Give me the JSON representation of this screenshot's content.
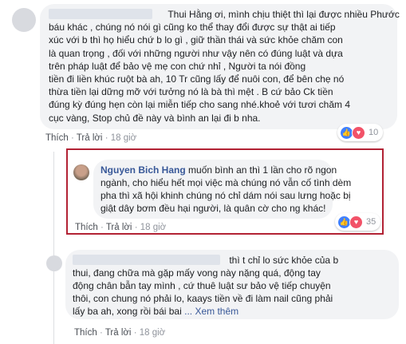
{
  "comment1": {
    "author": "",
    "lines": [
      "Thui Hằng ơi, mình chịu thiệt thì lại được nhiều Phước",
      "báu khác , chúng nó nói gì cũng ko thể thay đổi được sự thật ai tiếp",
      "xúc với b thì họ hiểu chứ b lo gì , giữ thần thái và sức khỏe chăm con",
      "là quan trọng , đối với những người như vậy nên có đúng luật và dựa",
      "trên pháp luật để bảo vệ mẹ con chứ nhỉ , Người ta nói đồng",
      "tiền đi liền khúc ruột bà ah, 10 Tr cũng lấy để nuôi con, để bên chẹ nó",
      "thừa tiền lại dững mỡ với tưởng nó là bà thì mệt . B cứ bảo Ck tiền",
      "đúng kỳ đúng hẹn còn lại miễn tiếp cho sang nhé.khoẻ với tươi chăm 4",
      "cục vàng, Stop chủ đề này và bình an lại đi b nha."
    ],
    "reaction_count": "10",
    "actions": {
      "like": "Thích",
      "reply": "Trả lời",
      "sep": "·",
      "time": "18 giờ"
    }
  },
  "comment2": {
    "author": "Nguyen Bich Hang",
    "first_line": " muốn bình an thì 1 lần cho rõ ngon",
    "lines": [
      "ngành, cho hiểu hết mọi việc mà chúng nó vẫn cố tình dèm",
      "pha thì xã hội khinh chúng nó chỉ dám nói sau lưng hoặc bị",
      "giật dây bơm đều hại người, là quân cờ cho ng khác!"
    ],
    "reaction_count": "35",
    "actions": {
      "like": "Thích",
      "reply": "Trả lời",
      "sep": "·",
      "time": "18 giờ"
    }
  },
  "comment3": {
    "author": "",
    "first_line": "thì t chỉ lo sức khỏe của b",
    "lines": [
      "thui, đang chữa mà gặp mấy vong này nặng quá, động tay",
      "động chân bẫn tay mình , cứ thuê luật sư bảo vệ tiếp chuyện",
      "thôi, con chung nó phải lo, kaays tiền về đi làm nail cũng phải",
      "lấy ba ah, xong rồi bái bai"
    ],
    "see_more": "... Xem thêm",
    "actions": {
      "like": "Thích",
      "reply": "Trả lời",
      "sep": "·",
      "time": "18 giờ"
    }
  },
  "colors": {
    "name": "#385898",
    "bubble": "#f2f3f5",
    "highlight": "#b22234",
    "like": "#4080ff",
    "love": "#f25268"
  },
  "icons": [
    "like-icon",
    "love-icon"
  ]
}
